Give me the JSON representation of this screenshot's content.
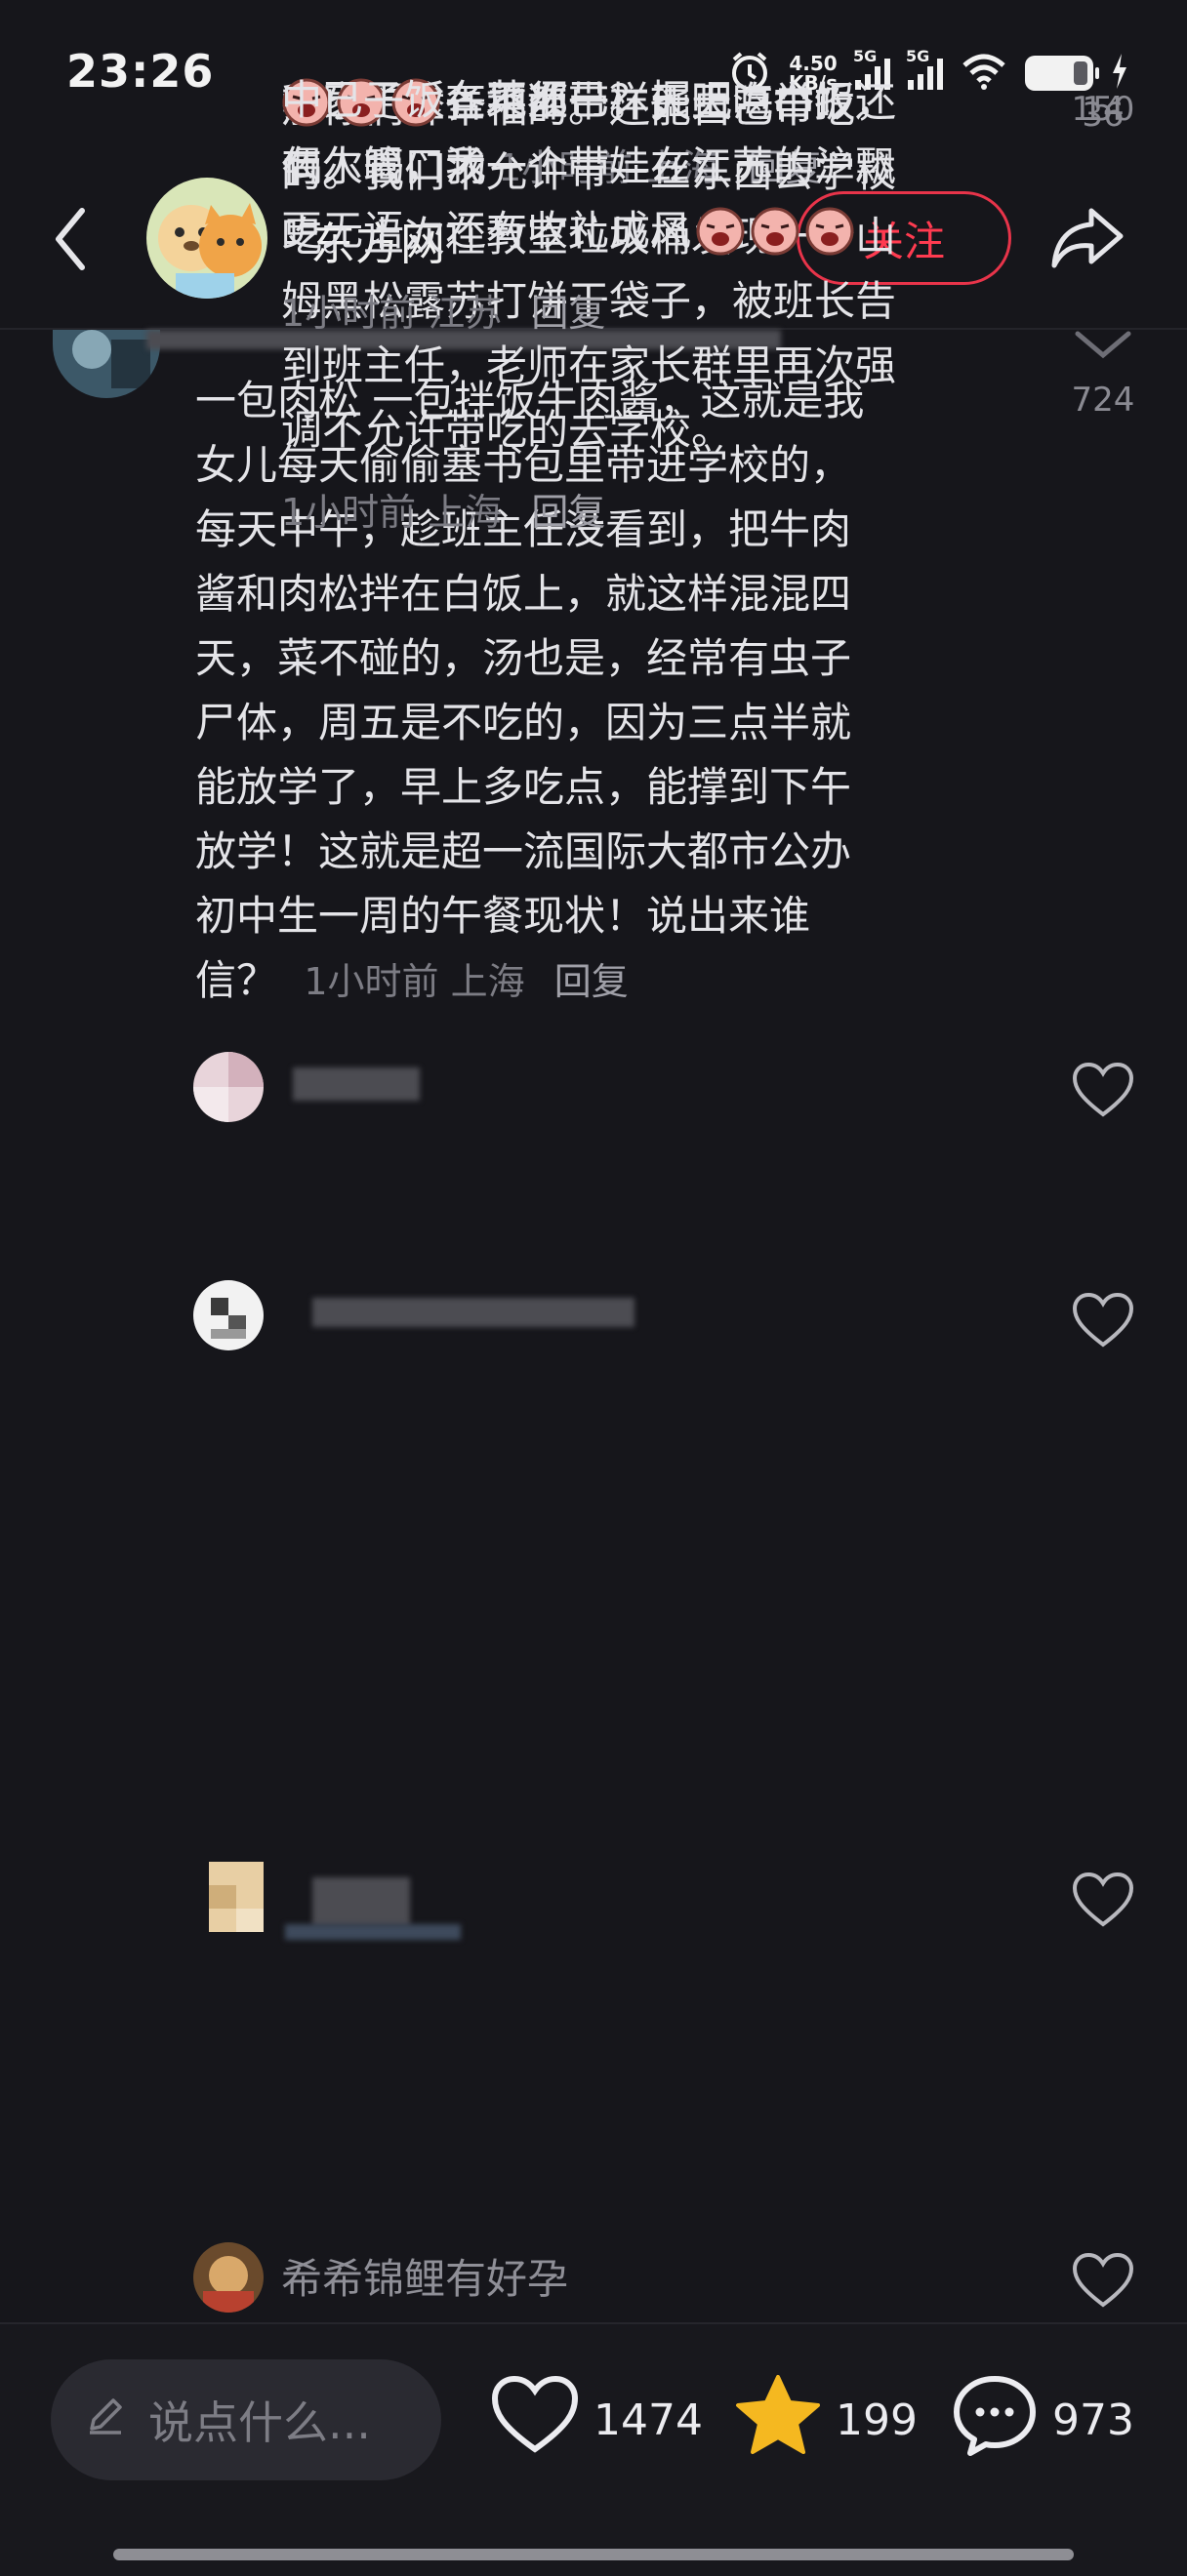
{
  "status_bar": {
    "time": "23:26",
    "net_speed_value": "4.50",
    "net_speed_unit": "KB/s",
    "sim1": "5G",
    "sim2": "5G",
    "battery_level": 0.8
  },
  "header": {
    "account_name": "东方网",
    "follow_label": "关注"
  },
  "comments": [
    {
      "text": "一包肉松 一包拌饭牛肉酱，这就是我女儿每天偷偷塞书包里带进学校的，每天中午，趁班主任没看到，把牛肉酱和肉松拌在白饭上，就这样混混四天，菜不碰的，汤也是，经常有虫子尸体，周五是不吃的，因为三点半就能放学了，早上多吃点，能撑到下午放学！这就是超一流国际大都市公办初中生一周的午餐现状！说出来谁信？",
      "lines": [
        "一包肉松 一包拌饭牛肉酱，这就是我",
        "女儿每天偷偷塞书包里带进学校的，",
        "每天中午，趁班主任没看到，把牛肉",
        "酱和肉松拌在白饭上，就这样混混四",
        "天，菜不碰的，汤也是，经常有虫子",
        "尸体，周五是不吃的，因为三点半就",
        "能放学了，早上多吃点，能撑到下午",
        "放学！这就是超一流国际大都市公办",
        "初中生一周的午餐现状！说出来谁",
        "信？"
      ],
      "time": "1小时前",
      "location": "上海",
      "reply": "回复",
      "likes": "724"
    },
    {
      "lines": [
        "我家更惨，不准带。天天吃白饭，",
        "偶尔喝口汤"
      ],
      "time": "1小时前",
      "location": "上海",
      "reply": "回复",
      "likes": "150"
    },
    {
      "lines": [
        "那你们算幸福的。还能自己带吃",
        "的。我们不允许带一丝东西去学校",
        "吃。上次在教室垃圾桶发现一个山",
        "姆黑松露苏打饼干袋子，被班长告",
        "到班主任，老师在家长群里再次强",
        "调不允许带吃的去学校。"
      ],
      "time": "1小时前",
      "location": "上海",
      "reply": "回复",
      "likes": "36"
    },
    {
      "lines": [
        "各地都一样，上海举报还",
        "有人管，我一个带娃在江苏的沪飘",
        "更无语，还有收礼成风"
      ],
      "time": "1小时前",
      "location": "江苏",
      "reply": "回复",
      "likes": "14"
    },
    {
      "username": "希希锦鲤有好孕",
      "partial_line": "中已子饭在菜须已？掘吧"
    }
  ],
  "bottom_bar": {
    "input_placeholder": "说点什么...",
    "likes": "1474",
    "favorites": "199",
    "comments": "973"
  },
  "colors": {
    "background": "#16161b",
    "accent": "#ff3b50",
    "star": "#f5b820"
  }
}
